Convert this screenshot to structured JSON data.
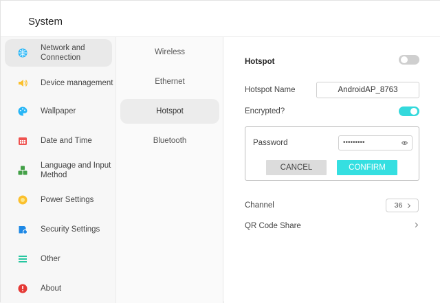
{
  "window": {
    "title": "System"
  },
  "sidebar": {
    "items": [
      {
        "label": "Network and Connection",
        "icon": "globe-icon",
        "color": "#29b6f6",
        "active": true
      },
      {
        "label": "Device management",
        "icon": "speaker-icon",
        "color": "#fbc02d"
      },
      {
        "label": "Wallpaper",
        "icon": "palette-icon",
        "color": "#29b6f6"
      },
      {
        "label": "Date and Time",
        "icon": "calendar-icon",
        "color": "#ef5350"
      },
      {
        "label": "Language and Input Method",
        "icon": "apps-icon",
        "color": "#43a047"
      },
      {
        "label": "Power Settings",
        "icon": "power-icon",
        "color": "#fbc02d"
      },
      {
        "label": "Security Settings",
        "icon": "shield-icon",
        "color": "#1e88e5"
      },
      {
        "label": "Other",
        "icon": "list-icon",
        "color": "#26c6a0"
      },
      {
        "label": "About",
        "icon": "info-icon",
        "color": "#e53935"
      }
    ]
  },
  "network_menu": {
    "items": [
      {
        "label": "Wireless"
      },
      {
        "label": "Ethernet"
      },
      {
        "label": "Hotspot",
        "active": true
      },
      {
        "label": "Bluetooth"
      }
    ]
  },
  "hotspot": {
    "title": "Hotspot",
    "enabled": false,
    "name_label": "Hotspot Name",
    "name_value": "AndroidAP_8763",
    "encrypted_label": "Encrypted?",
    "encrypted": true,
    "password_dialog": {
      "password_label": "Password",
      "password_value": "•••••••••",
      "cancel_label": "CANCEL",
      "confirm_label": "CONFIRM"
    },
    "channel_label": "Channel",
    "channel_value": "36",
    "qr_label": "QR Code Share"
  },
  "colors": {
    "accent": "#34d9dc",
    "toggle_off": "#cfcfcf",
    "cancel_bg": "#dcdcdc"
  }
}
